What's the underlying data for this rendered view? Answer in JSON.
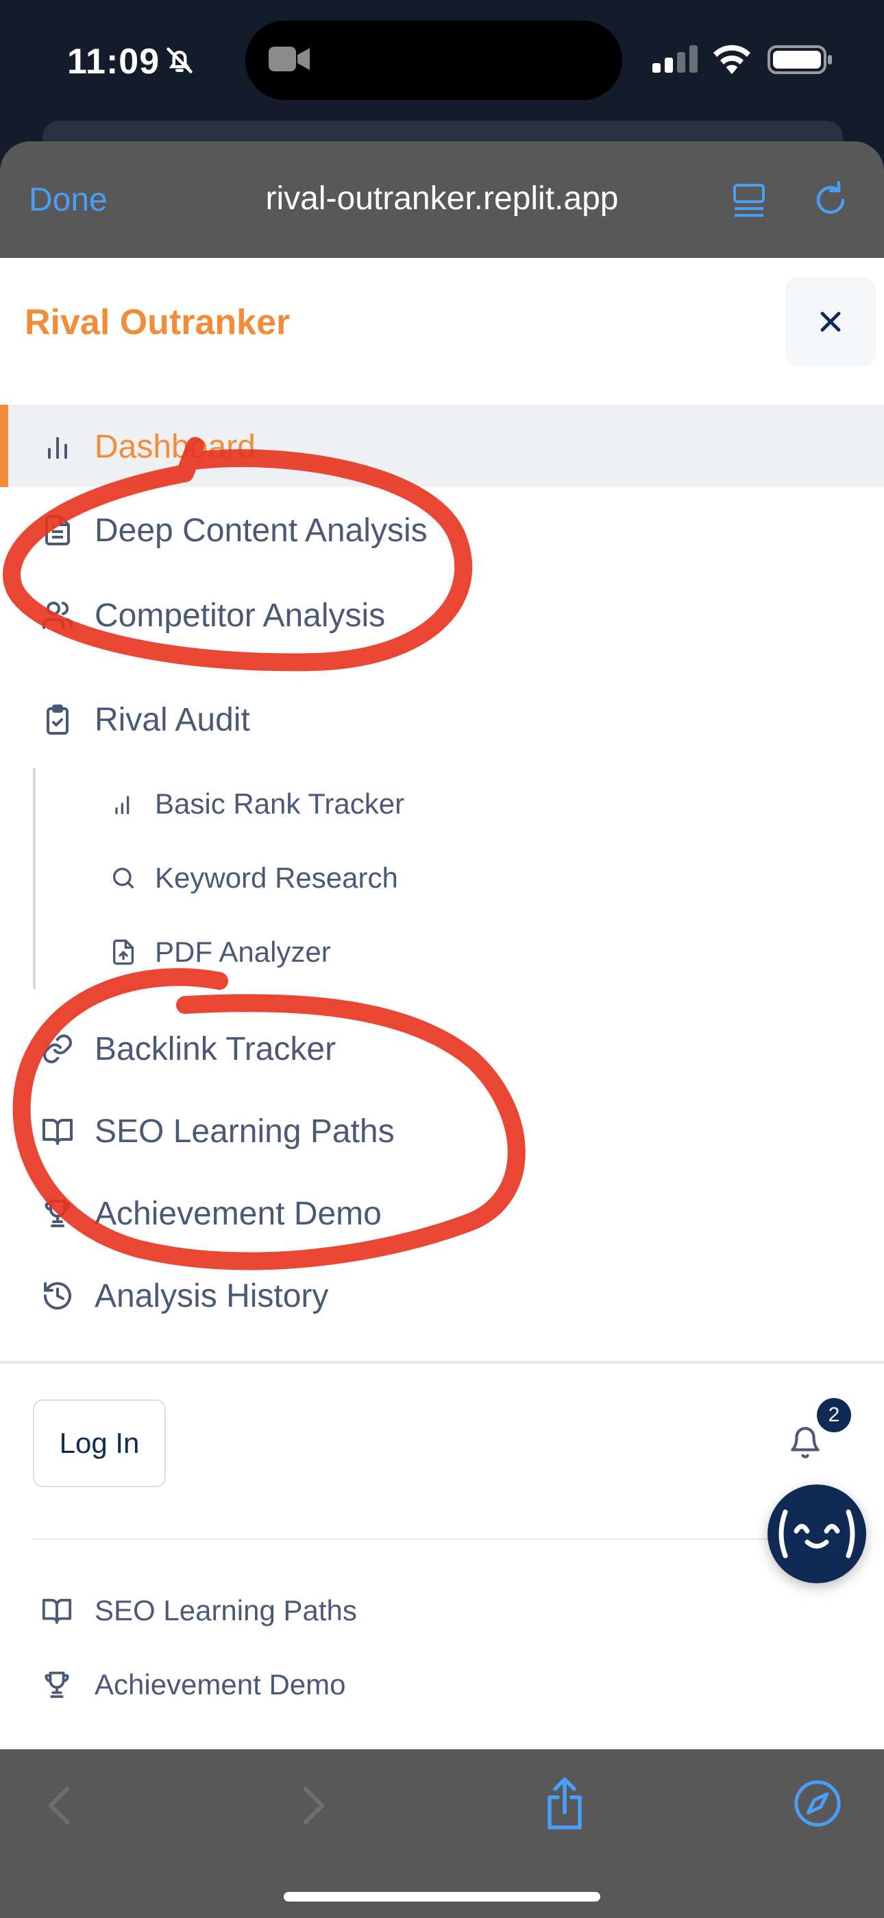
{
  "status_bar": {
    "time": "11:09"
  },
  "browser": {
    "done_label": "Done",
    "url": "rival-outranker.replit.app"
  },
  "app": {
    "brand": "Rival Outranker"
  },
  "nav": {
    "items": [
      {
        "label": "Dashboard",
        "icon": "bar-chart-icon",
        "active": true
      },
      {
        "label": "Deep Content Analysis",
        "icon": "document-icon"
      },
      {
        "label": "Competitor Analysis",
        "icon": "users-icon"
      },
      {
        "label": "Rival Audit",
        "icon": "clipboard-check-icon"
      }
    ],
    "sub_items": [
      {
        "label": "Basic Rank Tracker",
        "icon": "signal-bars-icon"
      },
      {
        "label": "Keyword Research",
        "icon": "search-icon"
      },
      {
        "label": "PDF Analyzer",
        "icon": "file-upload-icon"
      }
    ],
    "items_after": [
      {
        "label": "Backlink Tracker",
        "icon": "link-icon"
      },
      {
        "label": "SEO Learning Paths",
        "icon": "book-open-icon"
      },
      {
        "label": "Achievement Demo",
        "icon": "trophy-icon"
      },
      {
        "label": "Analysis History",
        "icon": "history-icon"
      }
    ]
  },
  "footer": {
    "login_label": "Log In",
    "notification_count": "2",
    "links": [
      {
        "label": "SEO Learning Paths",
        "icon": "book-open-icon"
      },
      {
        "label": "Achievement Demo",
        "icon": "trophy-icon"
      }
    ]
  },
  "colors": {
    "brand": "#f28c38",
    "nav_text": "#4a5a76",
    "navy": "#0f2a54",
    "safari_blue": "#4a9ef5",
    "annotation_red": "#e8321e"
  }
}
